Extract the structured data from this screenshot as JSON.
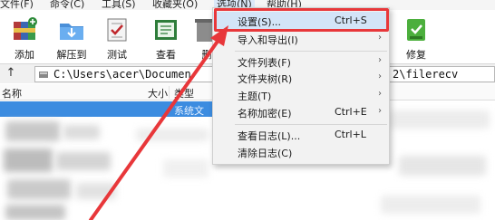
{
  "menubar": {
    "items": [
      "文件(F)",
      "命令(C)",
      "工具(S)",
      "收藏夹(O)",
      "选项(N)",
      "帮助(H)"
    ]
  },
  "toolbar": {
    "buttons": [
      {
        "label": "添加",
        "icon": "add-archive-icon"
      },
      {
        "label": "解压到",
        "icon": "extract-to-icon"
      },
      {
        "label": "测试",
        "icon": "test-icon"
      },
      {
        "label": "查看",
        "icon": "view-icon"
      },
      {
        "label": "删",
        "icon": "delete-icon"
      },
      {
        "label": "修复",
        "icon": "repair-icon"
      }
    ]
  },
  "address": {
    "path_left": "C:\\Users\\acer\\Documen",
    "path_right": "2\\filerecv"
  },
  "columns": {
    "name": "名称",
    "size": "大小",
    "type": "类型"
  },
  "filelist": {
    "selected_type": "系统文"
  },
  "options_menu": {
    "items": [
      {
        "label": "设置(S)...",
        "shortcut": "Ctrl+S",
        "submenu": false
      },
      {
        "label": "导入和导出(I)",
        "shortcut": "",
        "submenu": true
      },
      {
        "label": "文件列表(F)",
        "shortcut": "",
        "submenu": true
      },
      {
        "label": "文件夹树(R)",
        "shortcut": "",
        "submenu": true
      },
      {
        "label": "主题(T)",
        "shortcut": "",
        "submenu": true
      },
      {
        "label": "名称加密(E)",
        "shortcut": "Ctrl+E",
        "submenu": true
      },
      {
        "label": "查看日志(L)...",
        "shortcut": "Ctrl+L",
        "submenu": false
      },
      {
        "label": "清除日志(C)",
        "shortcut": "",
        "submenu": false
      }
    ]
  },
  "colors": {
    "highlight": "#e8373a",
    "selection": "#3c8ce0",
    "menu_hover": "#d3e4f7"
  }
}
